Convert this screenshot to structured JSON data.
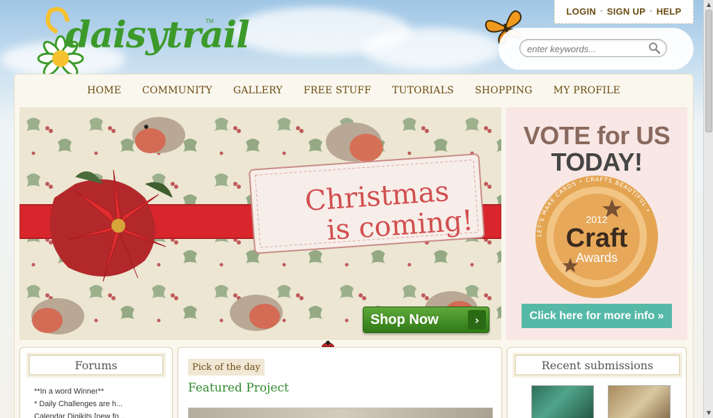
{
  "brand": {
    "logo_text": "daisytrail",
    "trademark": "TM"
  },
  "account": {
    "login": "LOGIN",
    "signup": "SIGN UP",
    "help": "HELP"
  },
  "search": {
    "placeholder": "enter keywords..."
  },
  "nav": {
    "items": [
      "HOME",
      "COMMUNITY",
      "GALLERY",
      "FREE STUFF",
      "TUTORIALS",
      "SHOPPING",
      "MY PROFILE"
    ]
  },
  "banner": {
    "headline_line1": "Christmas",
    "headline_line2": "is coming!",
    "cta": "Shop Now",
    "cta_arrow": "›"
  },
  "vote": {
    "line1": "VOTE for US",
    "line2": "TODAY!",
    "badge_year": "2012",
    "badge_main": "Craft",
    "badge_sub": "Awards",
    "badge_ring_text": "LET'S MAKE CARDS • CRAFTS BEAUTIFUL •",
    "button": "Click here for more info »"
  },
  "forums": {
    "title": "Forums",
    "items": [
      "**In a word Winner**",
      "* Daily Challenges are h...",
      "Calendar Digikits [new fo..."
    ]
  },
  "featured": {
    "tag": "Pick of the day",
    "title": "Featured Project"
  },
  "recent": {
    "title": "Recent submissions"
  },
  "colors": {
    "nav_text": "#6a4b12",
    "green": "#2e8a2b",
    "teal_button": "#56b9a7",
    "vote_bg": "#f8e7e5"
  }
}
